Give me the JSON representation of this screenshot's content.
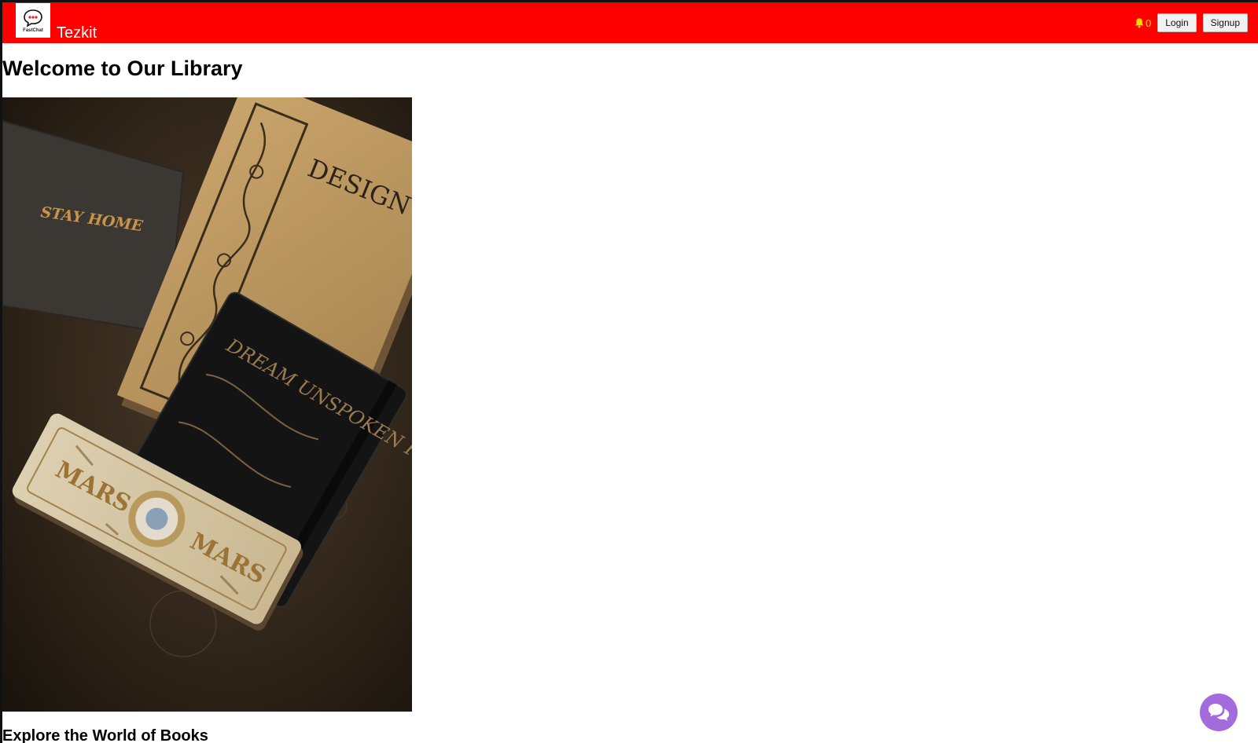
{
  "navbar": {
    "logo_text": "FastChat",
    "brand": "Tezkit",
    "notification_count": "0",
    "login_label": "Login",
    "signup_label": "Signup"
  },
  "main": {
    "title": "Welcome to Our Library",
    "hero_image_alt": "Vintage books and a notebook on a dark wooden table",
    "hero_texts": [
      "STAY HOME",
      "DESIGN IN THEORY",
      "DREAM UNSPOKEN FORGOTTEN",
      "MARS",
      "MARS"
    ],
    "section_heading": "Explore the World of Books"
  },
  "colors": {
    "navbar_bg": "#ff0000",
    "bell": "#ffd700",
    "chat_fab": "#a36bdc"
  },
  "icons": {
    "bell": "bell-icon",
    "chat": "chat-icon"
  }
}
